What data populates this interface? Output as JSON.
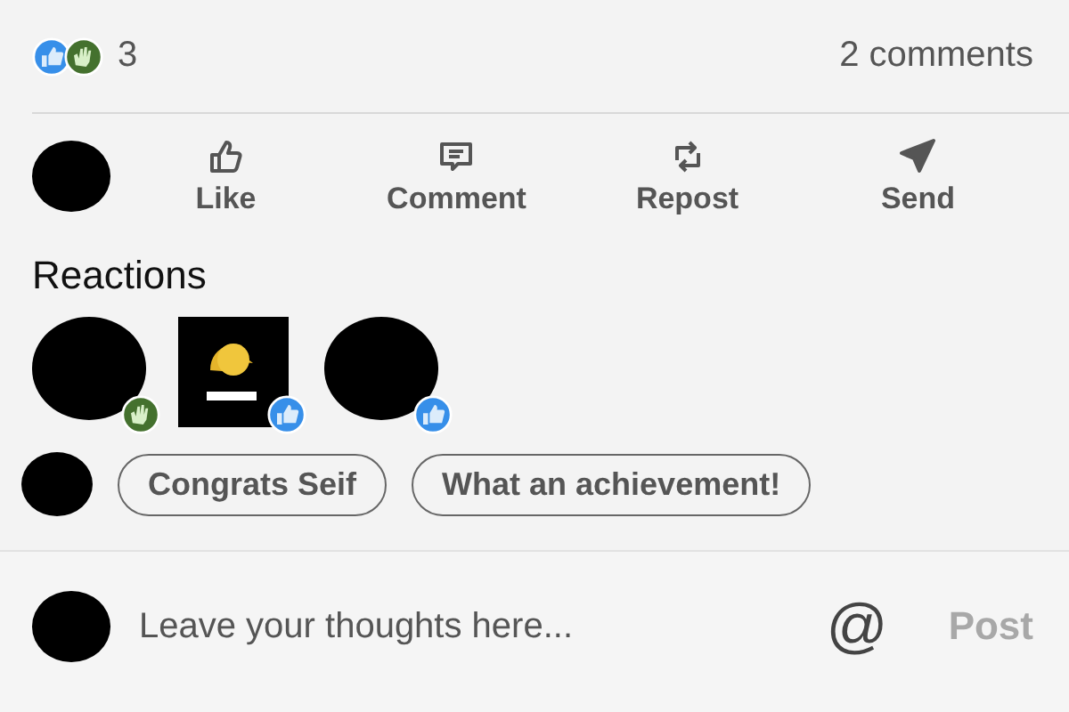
{
  "summary": {
    "reactions": [
      {
        "kind": "like"
      },
      {
        "kind": "celebrate"
      }
    ],
    "count": "3",
    "comments": "2 comments"
  },
  "actions": [
    {
      "kind": "like",
      "label": "Like"
    },
    {
      "kind": "comment",
      "label": "Comment"
    },
    {
      "kind": "repost",
      "label": "Repost"
    },
    {
      "kind": "send",
      "label": "Send"
    }
  ],
  "reactions_heading": "Reactions",
  "reactors": [
    {
      "kind": "avatar",
      "badge": {
        "kind": "celebrate"
      }
    },
    {
      "kind": "picture",
      "badge": {
        "kind": "like"
      }
    },
    {
      "kind": "avatar",
      "badge": {
        "kind": "like"
      }
    }
  ],
  "suggestions": [
    "Congrats Seif",
    "What an achievement!"
  ],
  "composer": {
    "placeholder": "Leave your thoughts here...",
    "mention": "@",
    "post": "Post",
    "post_disabled": true
  }
}
